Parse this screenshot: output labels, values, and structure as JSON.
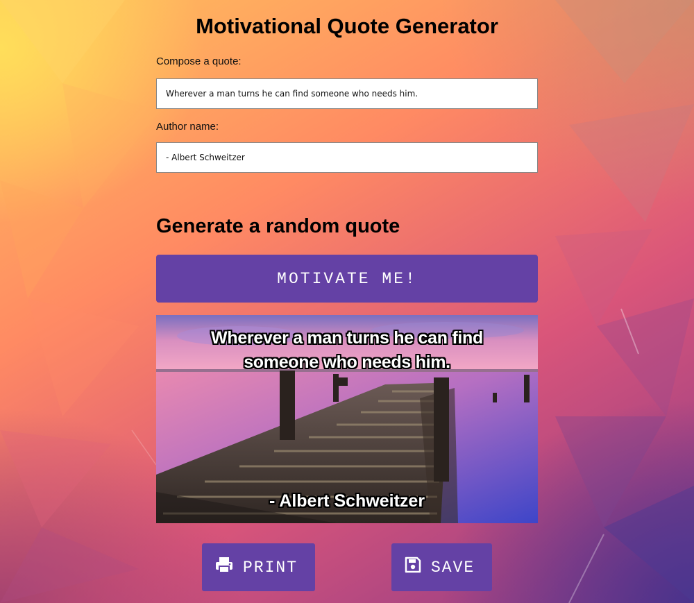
{
  "app": {
    "title": "Motivational Quote Generator"
  },
  "compose": {
    "quote_label": "Compose a quote:",
    "quote_value": "Wherever a man turns he can find someone who needs him.",
    "author_label": "Author name:",
    "author_value": "- Albert Schweitzer"
  },
  "random": {
    "heading": "Generate a random quote",
    "button_label": "MOTIVATE ME!"
  },
  "card": {
    "quote_text": "Wherever a man turns he can find someone who needs him.",
    "author_text": "- Albert Schweitzer",
    "image_subject": "wooden pier over calm lake at dusk"
  },
  "actions": {
    "print_label": "PRINT",
    "print_icon": "printer-icon",
    "save_label": "SAVE",
    "save_icon": "floppy-disk-icon"
  },
  "colors": {
    "button_bg": "#6441a5",
    "button_text": "#ffffff"
  }
}
